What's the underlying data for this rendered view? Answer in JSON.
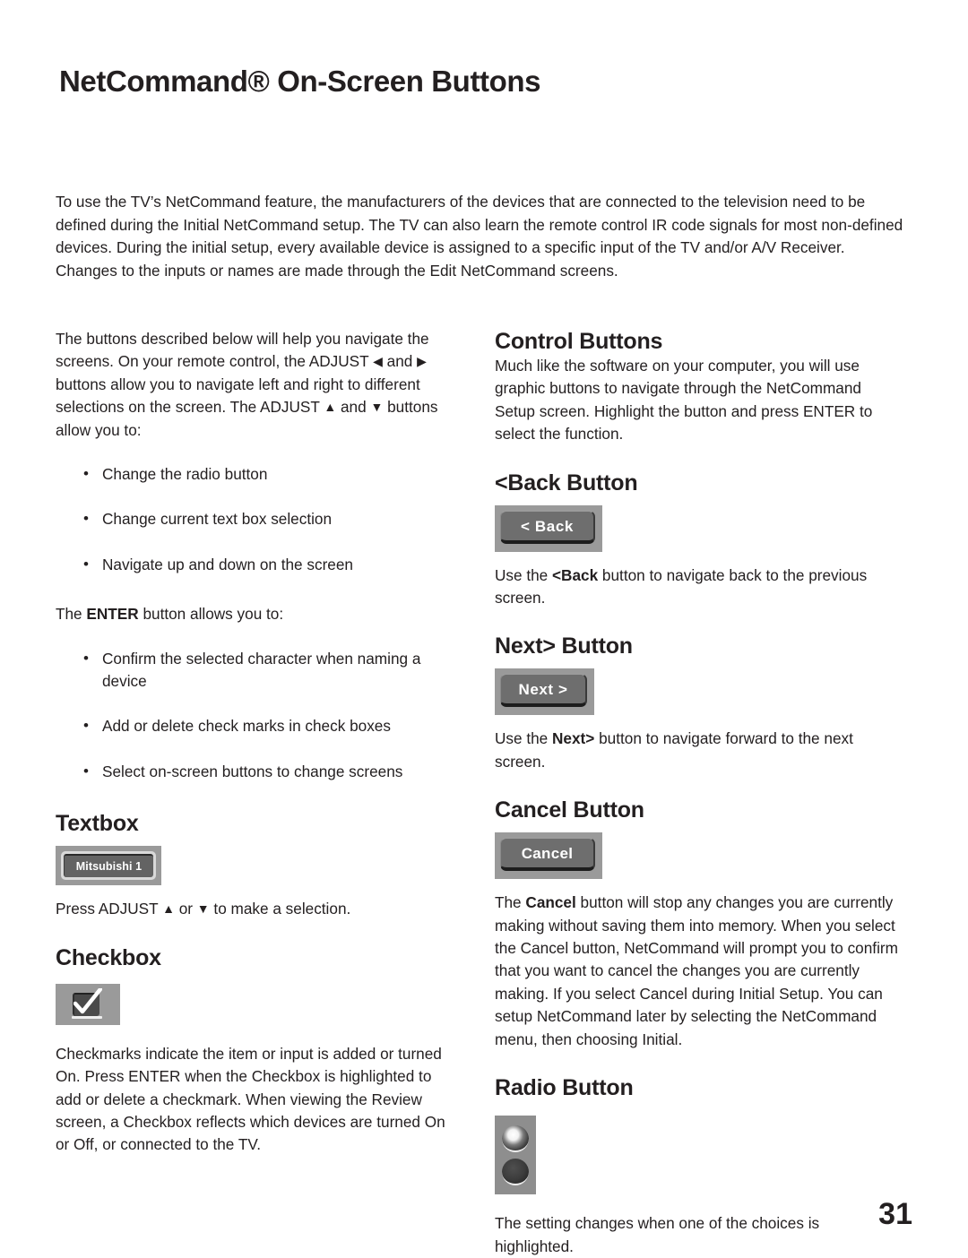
{
  "document": {
    "title": "NetCommand® On-Screen Buttons",
    "page_number": "31",
    "intro": "To use the TV’s NetCommand feature, the manufacturers of the devices that are connected to the television need to be defined during the Initial NetCommand setup.  The TV can also learn the remote control IR code signals for most non-defined devices.  During the initial setup, every available device is assigned to a specific input of the TV and/or A/V Receiver.  Changes to the inputs or names are made through the Edit NetCommand screens."
  },
  "left_column": {
    "navigation_paragraph": {
      "part1": "The buttons described below will help you navigate the screens.  On your remote control, the ADJUST ",
      "arrow_left": "◀",
      "part2": " and ",
      "arrow_right": "▶",
      "part3": " buttons allow you to navigate left and right to different selections on the screen. The ADJUST ",
      "arrow_up": "▲",
      "part4": " and ",
      "arrow_down": "▼",
      "part5": " buttons allow you to:"
    },
    "adjust_bullets": [
      "Change the radio button",
      "Change current text box selection",
      "Navigate up and down on the screen"
    ],
    "enter_paragraph": {
      "prefix": "The ",
      "bold": "ENTER",
      "suffix": " button allows you to:"
    },
    "enter_bullets": [
      "Confirm the selected character when naming a device",
      "Add or delete check marks in check boxes",
      "Select on-screen buttons to change screens"
    ],
    "textbox": {
      "heading": "Textbox",
      "graphic_label": "Mitsubishi 1",
      "caption": {
        "part1": "Press ADJUST ",
        "arrow_up": "▲",
        "part2": " or ",
        "arrow_down": "▼",
        "part3": " to make a selection."
      }
    },
    "checkbox": {
      "heading": "Checkbox",
      "body": "Checkmarks indicate the item or input is added or turned On.  Press ENTER when the Checkbox is highlighted to add or delete a checkmark. When viewing the Review screen, a Checkbox reflects which devices are turned On or Off, or connected to the TV."
    }
  },
  "right_column": {
    "control_buttons": {
      "heading": "Control Buttons",
      "body": "Much like the software on your computer, you will use graphic buttons to navigate through the NetCommand Setup screen.  Highlight the button and press ENTER to select the function."
    },
    "back_button": {
      "heading": "<Back Button",
      "graphic_label": "< Back",
      "body": {
        "prefix": "Use the ",
        "bold": "<Back",
        "suffix": " button to navigate back to the previous screen."
      }
    },
    "next_button": {
      "heading": "Next> Button",
      "graphic_label": "Next >",
      "body": {
        "prefix": "Use the ",
        "bold": "Next>",
        "suffix": " button to navigate forward to the next screen."
      }
    },
    "cancel_button": {
      "heading": "Cancel Button",
      "graphic_label": "Cancel",
      "body": {
        "prefix": "The ",
        "bold": "Cancel",
        "suffix": " button will stop any changes you are currently making without saving them into memory.  When you select the Cancel button, NetCommand will prompt you to confirm that you want to cancel the changes you are currently making.  If you select Cancel during Initial Setup.  You can setup NetCommand later by selecting the NetCommand menu, then choosing Initial."
      }
    },
    "radio_button": {
      "heading": "Radio Button",
      "body": "The setting changes when one of the choices is highlighted.",
      "states": [
        "selected",
        "unselected"
      ]
    }
  },
  "colors": {
    "text": "#231f20",
    "graphic_plate": "#9a9a9a",
    "graphic_cap": "#6e6e6e",
    "graphic_label": "#ffffff"
  }
}
